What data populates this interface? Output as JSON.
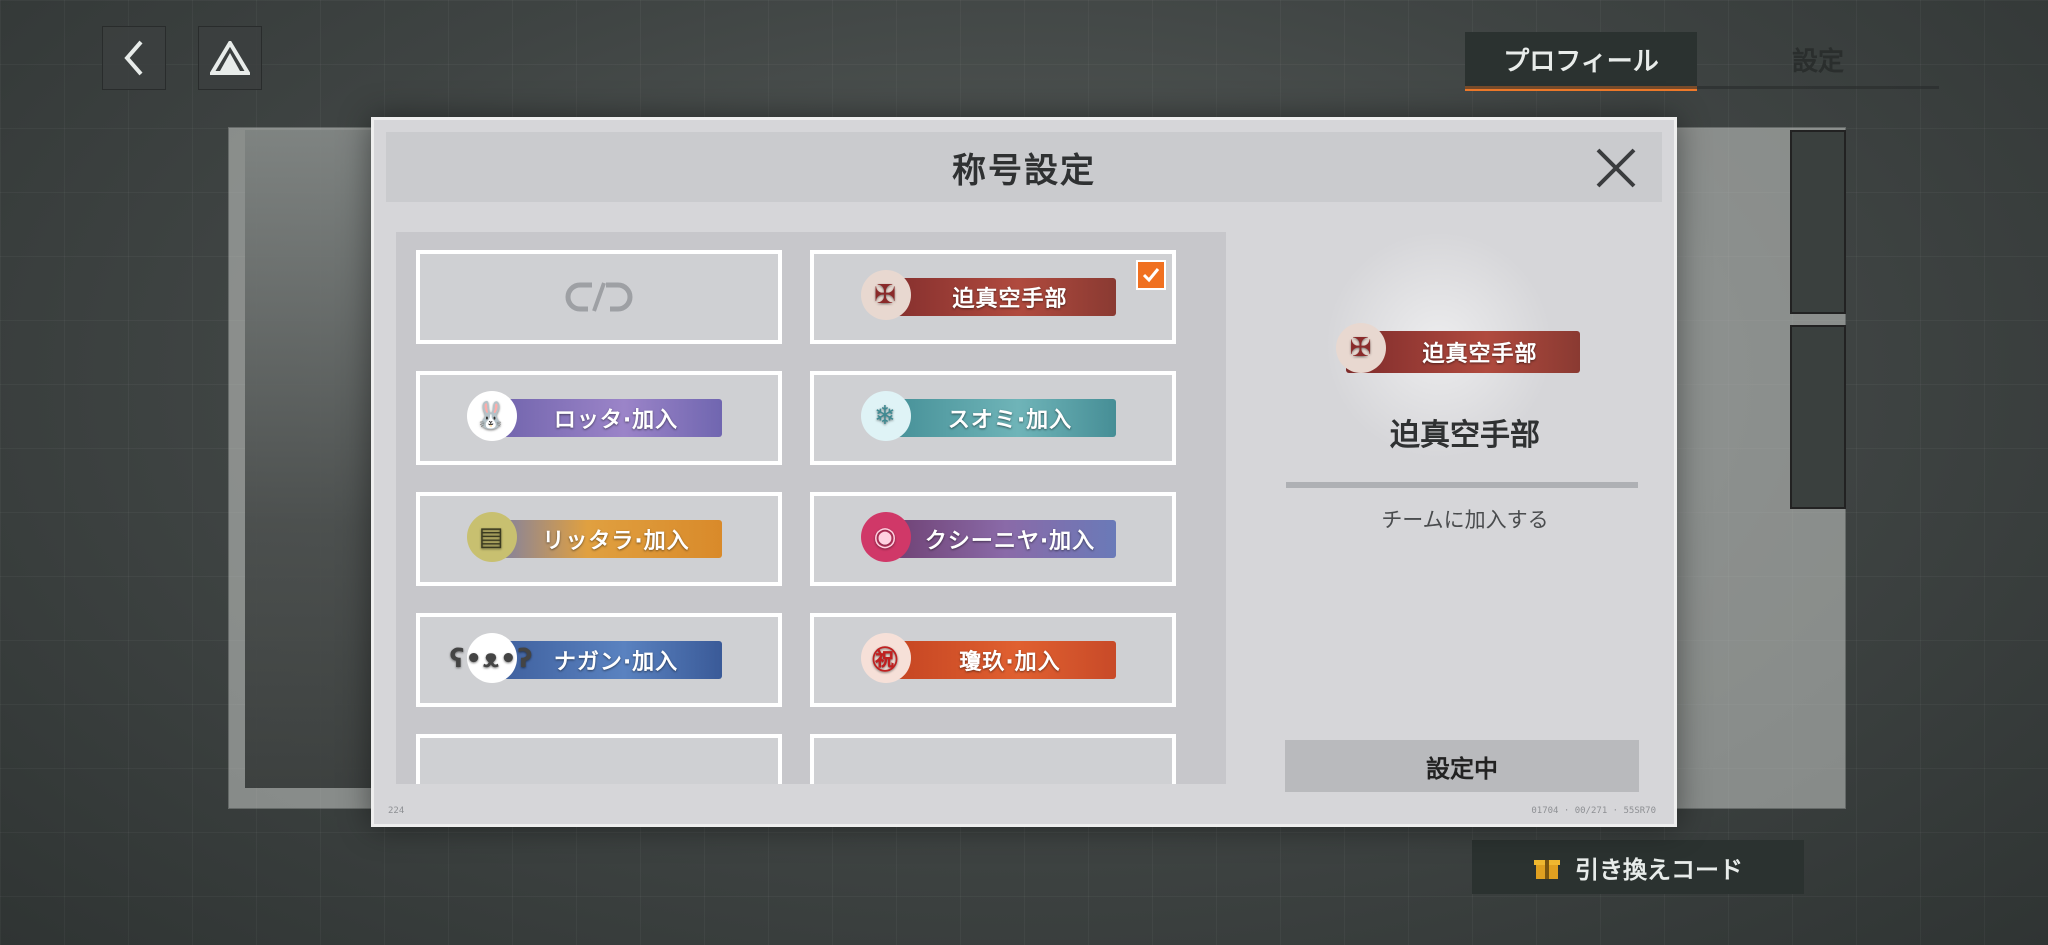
{
  "nav": {
    "back_icon": "chevron-left-icon",
    "home_icon": "triangle-logo-icon"
  },
  "tabs": [
    {
      "label": "プロフィール",
      "active": true
    },
    {
      "label": "設定",
      "active": false
    }
  ],
  "redeem": {
    "label": "引き換えコード",
    "icon": "gift-icon"
  },
  "modal": {
    "title": "称号設定",
    "close_icon": "close-icon",
    "footer_left": "224",
    "footer_right": "01704 · 00/271 · 55SR70",
    "titles": [
      {
        "label": "",
        "icon": "unlink-icon",
        "empty": true
      },
      {
        "label": "迫真空手部",
        "selected": true
      },
      {
        "label": "ロッタ·加入"
      },
      {
        "label": "スオミ·加入"
      },
      {
        "label": "リッタラ·加入"
      },
      {
        "label": "クシーニヤ·加入"
      },
      {
        "label": "ナガン·加入"
      },
      {
        "label": "瓊玖·加入"
      }
    ],
    "detail": {
      "badge_label": "迫真空手部",
      "name": "迫真空手部",
      "description": "チームに加入する",
      "button_label": "設定中"
    }
  },
  "colors": {
    "accent": "#f07020",
    "modal_bg": "#d6d6d9"
  }
}
